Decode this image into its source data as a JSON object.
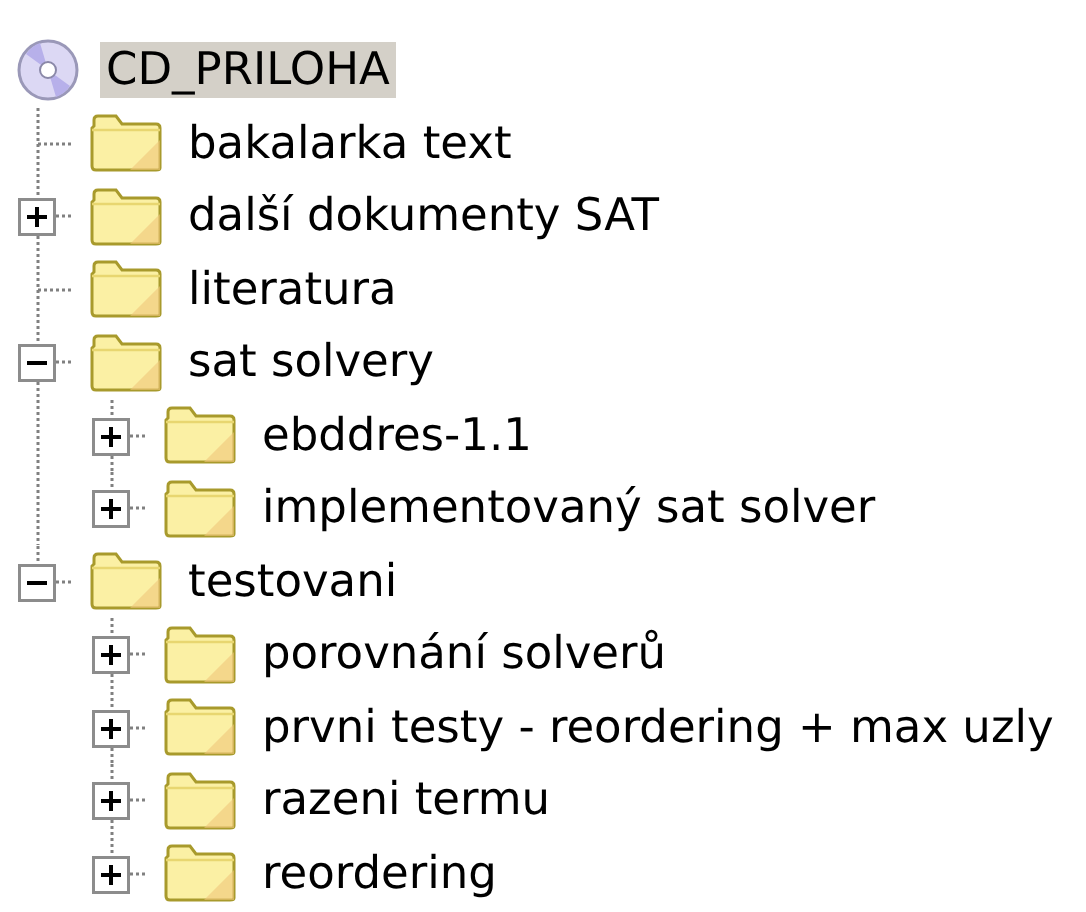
{
  "tree": {
    "label": "CD_PRILOHA",
    "selected": true,
    "children": [
      {
        "label": "bakalarka text",
        "selected": false
      },
      {
        "label": "další dokumenty SAT",
        "selected": false,
        "expanded": false
      },
      {
        "label": "literatura",
        "selected": false
      },
      {
        "label": "sat solvery",
        "selected": false,
        "expanded": true,
        "children": [
          {
            "label": "ebddres-1.1",
            "selected": false,
            "expanded": false
          },
          {
            "label": "implementovaný sat solver",
            "selected": false,
            "expanded": false
          }
        ]
      },
      {
        "label": "testovani",
        "selected": false,
        "expanded": true,
        "children": [
          {
            "label": "porovnání solverů",
            "selected": false,
            "expanded": false
          },
          {
            "label": "prvni testy - reordering + max uzly",
            "selected": false,
            "expanded": false
          },
          {
            "label": "razeni termu",
            "selected": false,
            "expanded": false
          },
          {
            "label": "reordering",
            "selected": false,
            "expanded": false
          }
        ]
      }
    ]
  }
}
